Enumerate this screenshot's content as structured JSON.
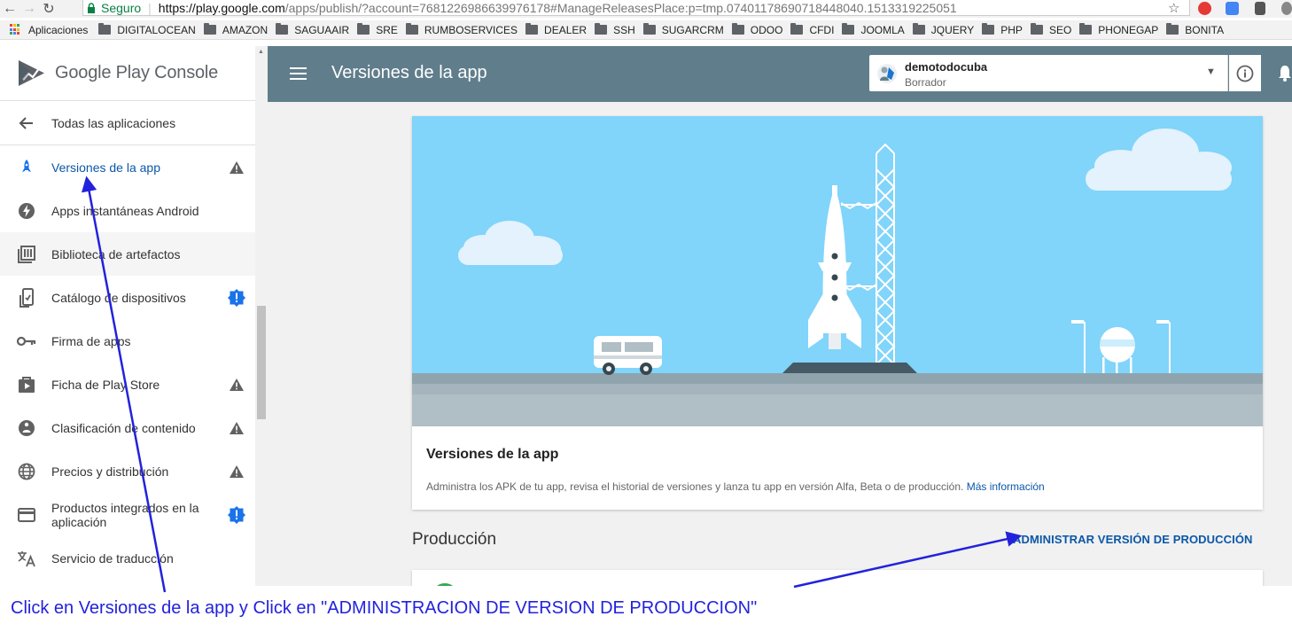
{
  "browser": {
    "secure_label": "Seguro",
    "url_host": "https://play.google.com",
    "url_path": "/apps/publish/?account=7681226986639976178#ManageReleasesPlace:p=tmp.07401178690718448040.1513319225051",
    "icons": [
      "back-arrow-icon",
      "forward-arrow-icon",
      "reload-icon",
      "lock-icon",
      "star-icon"
    ]
  },
  "bookmarks": [
    {
      "label": "Aplicaciones"
    },
    {
      "label": "DIGITALOCEAN"
    },
    {
      "label": "AMAZON"
    },
    {
      "label": "SAGUAAIR"
    },
    {
      "label": "SRE"
    },
    {
      "label": "RUMBOSERVICES"
    },
    {
      "label": "DEALER"
    },
    {
      "label": "SSH"
    },
    {
      "label": "SUGARCRM"
    },
    {
      "label": "ODOO"
    },
    {
      "label": "CFDI"
    },
    {
      "label": "JOOMLA"
    },
    {
      "label": "JQUERY"
    },
    {
      "label": "PHP"
    },
    {
      "label": "SEO"
    },
    {
      "label": "PHONEGAP"
    },
    {
      "label": "BONITA"
    }
  ],
  "sidebar": {
    "logo_text": "Google Play Console",
    "back_label": "Todas las aplicaciones",
    "items": [
      {
        "label": "Versiones de la app",
        "icon": "rocket-icon",
        "badge": "warning"
      },
      {
        "label": "Apps instantáneas Android",
        "icon": "bolt-icon",
        "badge": ""
      },
      {
        "label": "Biblioteca de artefactos",
        "icon": "library-icon",
        "badge": ""
      },
      {
        "label": "Catálogo de dispositivos",
        "icon": "device-icon",
        "badge": "info"
      },
      {
        "label": "Firma de apps",
        "icon": "key-icon",
        "badge": ""
      },
      {
        "label": "Ficha de Play Store",
        "icon": "store-listing-icon",
        "badge": "warning"
      },
      {
        "label": "Clasificación de contenido",
        "icon": "rating-icon",
        "badge": "warning"
      },
      {
        "label": "Precios y distribución",
        "icon": "globe-icon",
        "badge": "warning"
      },
      {
        "label": "Productos integrados en la aplicación",
        "icon": "card-icon",
        "badge": "info"
      },
      {
        "label": "Servicio de traducción",
        "icon": "translate-icon",
        "badge": ""
      }
    ]
  },
  "header": {
    "title": "Versiones de la app",
    "app_name": "demotodocuba",
    "app_status": "Borrador",
    "color": "#607d8b"
  },
  "main": {
    "card_title": "Versiones de la app",
    "card_desc": "Administra los APK de tu app, revisa el historial de versiones y lanza tu app en versión Alfa, Beta o de producción.",
    "card_link": "Más información",
    "section_title": "Producción",
    "production_button": "ADMINISTRAR VERSIÓN DE PRODUCCIÓN"
  },
  "annotation": {
    "text": "Click en Versiones de la app y Click en \"ADMINISTRACION DE VERSION DE PRODUCCION\"",
    "color": "#2222dd"
  }
}
